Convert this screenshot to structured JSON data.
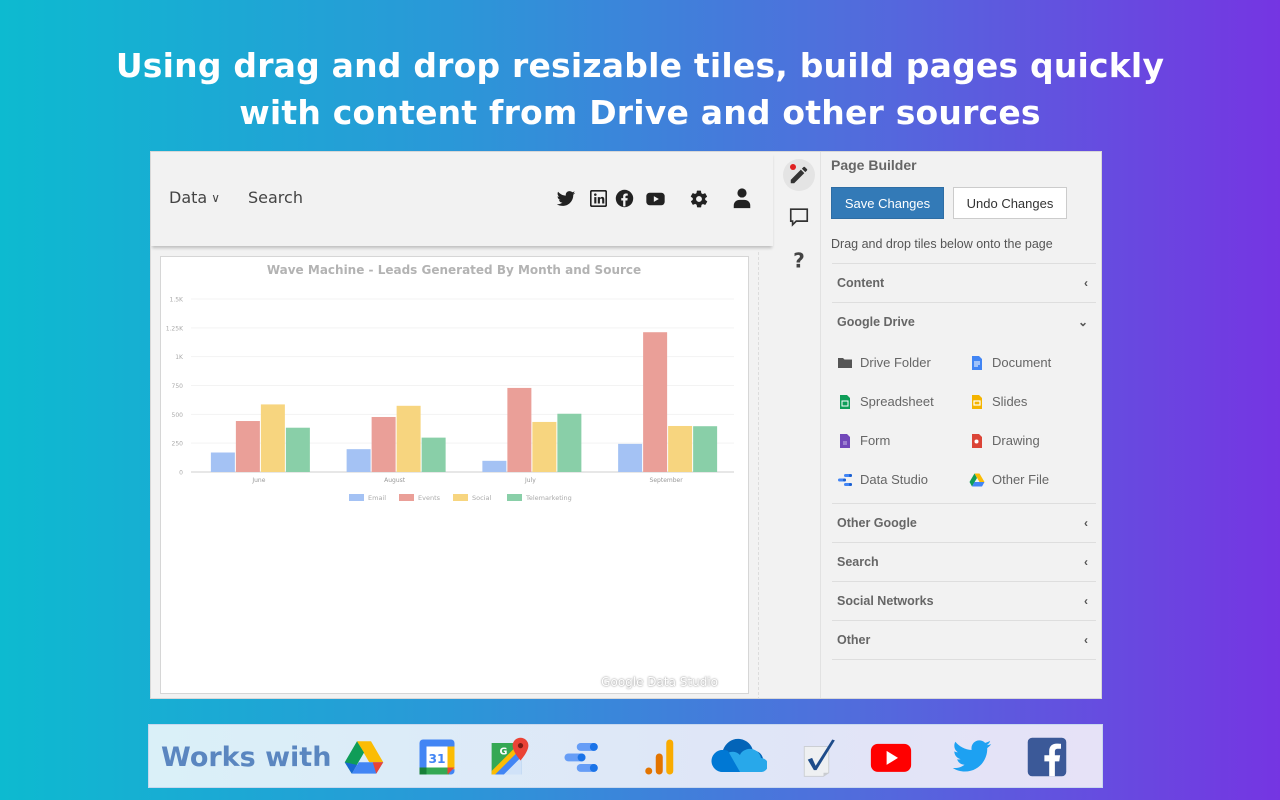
{
  "headline": {
    "line1": "Using drag and drop resizable tiles, build pages quickly",
    "line2": "with content from Drive and other sources"
  },
  "site_header": {
    "nav": [
      {
        "label": "Data",
        "has_dropdown": true
      },
      {
        "label": "Search",
        "has_dropdown": false
      }
    ],
    "icons": [
      "twitter-icon",
      "linkedin-icon",
      "facebook-icon",
      "youtube-icon",
      "gear-icon",
      "user-icon"
    ]
  },
  "tool_rail": [
    {
      "name": "edit-pencil",
      "active": true,
      "notification": true
    },
    {
      "name": "comment",
      "active": false
    },
    {
      "name": "help",
      "active": false,
      "glyph": "?"
    }
  ],
  "panel": {
    "title": "Page Builder",
    "save_label": "Save Changes",
    "undo_label": "Undo Changes",
    "hint": "Drag and drop tiles below onto the page",
    "sections": [
      {
        "label": "Content",
        "expanded": false,
        "chevron": "‹"
      },
      {
        "label": "Google Drive",
        "expanded": true,
        "chevron": "⌄",
        "items": [
          {
            "label": "Drive Folder",
            "icon": "folder"
          },
          {
            "label": "Document",
            "icon": "docs"
          },
          {
            "label": "Spreadsheet",
            "icon": "sheets"
          },
          {
            "label": "Slides",
            "icon": "slides"
          },
          {
            "label": "Form",
            "icon": "forms"
          },
          {
            "label": "Drawing",
            "icon": "drawing"
          },
          {
            "label": "Data Studio",
            "icon": "datastudio"
          },
          {
            "label": "Other File",
            "icon": "drive"
          }
        ]
      },
      {
        "label": "Other Google",
        "expanded": false,
        "chevron": "‹"
      },
      {
        "label": "Search",
        "expanded": false,
        "chevron": "‹"
      },
      {
        "label": "Social Networks",
        "expanded": false,
        "chevron": "‹"
      },
      {
        "label": "Other",
        "expanded": false,
        "chevron": "‹"
      }
    ]
  },
  "watermark": "Google Data Studio",
  "works_with": {
    "label": "Works with",
    "logos": [
      "google-drive",
      "google-calendar",
      "google-maps",
      "data-studio",
      "google-analytics",
      "onedrive",
      "checkmark-doc",
      "youtube",
      "twitter",
      "facebook"
    ],
    "calendar_day": "31"
  },
  "colors": {
    "gradient_start": "#0dbad0",
    "gradient_end": "#7535e2",
    "save_button": "#337ab7",
    "email": "#a4c2f4",
    "events": "#ea9f98",
    "social": "#f7d57f",
    "telemarketing": "#89cfa8"
  },
  "chart_data": {
    "type": "bar",
    "title": "Wave Machine - Leads Generated By Month and Source",
    "categories": [
      "June",
      "August",
      "July",
      "September"
    ],
    "series": [
      {
        "name": "Email",
        "color": "#a4c2f4",
        "values": [
          169,
          198,
          97,
          244
        ]
      },
      {
        "name": "Events",
        "color": "#ea9f98",
        "values": [
          442,
          477,
          729,
          1212
        ]
      },
      {
        "name": "Social",
        "color": "#f7d57f",
        "values": [
          586,
          574,
          434,
          399
        ]
      },
      {
        "name": "Telemarketing",
        "color": "#89cfa8",
        "values": [
          384,
          298,
          505,
          397
        ]
      }
    ],
    "xlabel": "",
    "ylabel": "",
    "ylim": [
      0,
      1500
    ],
    "yticks": [
      0,
      250,
      500,
      750,
      1000,
      1250,
      1500
    ],
    "ytick_labels": [
      "0",
      "250",
      "500",
      "750",
      "1K",
      "1.25K",
      "1.5K"
    ],
    "grid": true,
    "legend": "bottom"
  }
}
